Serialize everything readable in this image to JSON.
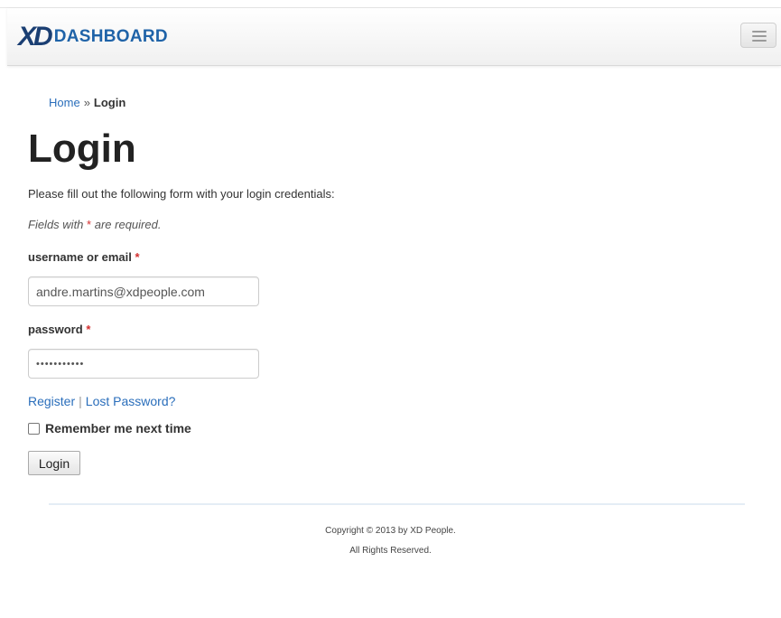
{
  "navbar": {
    "brand_mark": "XD",
    "brand_text": "DASHBOARD",
    "menu_icon": "hamburger-menu-icon"
  },
  "breadcrumb": {
    "home": "Home",
    "separator": "»",
    "current": "Login"
  },
  "page": {
    "title": "Login",
    "intro": "Please fill out the following form with your login credentials:",
    "note_prefix": "Fields with",
    "required_mark": "*",
    "note_suffix": "are required."
  },
  "form": {
    "username_label": "username or email",
    "username_value": "andre.martins@xdpeople.com",
    "password_label": "password",
    "password_value": "•••••••••••",
    "register_link": "Register",
    "link_separator": "|",
    "lost_password_link": "Lost Password?",
    "remember_label": "Remember me next time",
    "remember_checked": false,
    "submit_label": "Login"
  },
  "footer": {
    "copyright": "Copyright © 2013 by XD People.",
    "rights": "All Rights Reserved."
  },
  "colors": {
    "brand_dark": "#1b3f73",
    "brand_blue": "#1f63a8",
    "link": "#2a6ebb",
    "required": "#d32f2f"
  }
}
